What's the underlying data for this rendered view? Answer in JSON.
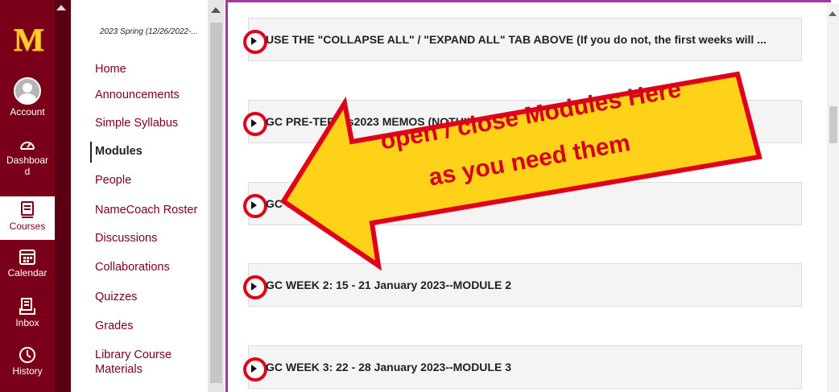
{
  "global_nav": {
    "logo": "M",
    "items": [
      {
        "label": "Account",
        "icon": "user-avatar-icon"
      },
      {
        "label": "Dashboar d",
        "icon": "dashboard-gauge-icon"
      },
      {
        "label": "Courses",
        "icon": "book-icon",
        "active": true
      },
      {
        "label": "Calendar",
        "icon": "calendar-icon"
      },
      {
        "label": "Inbox",
        "icon": "inbox-icon"
      },
      {
        "label": "History",
        "icon": "clock-icon"
      }
    ],
    "color": "#7a0019",
    "logo_color": "#ffcc33"
  },
  "course_nav": {
    "term": "2023 Spring (12/26/2022-...",
    "links": [
      {
        "label": "Home"
      },
      {
        "label": "Announcements"
      },
      {
        "label": "Simple Syllabus"
      },
      {
        "label": "Modules",
        "active": true
      },
      {
        "label": "People"
      },
      {
        "label": "NameCoach Roster"
      },
      {
        "label": "Discussions"
      },
      {
        "label": "Collaborations"
      },
      {
        "label": "Quizzes"
      },
      {
        "label": "Grades"
      },
      {
        "label": "Library Course Materials"
      }
    ]
  },
  "modules": [
    {
      "title": "USE THE \"COLLAPSE ALL\" / \"EXPAND ALL\" TAB ABOVE (If you do not, the first weeks will ..."
    },
    {
      "title": "GC PRE-TERM s2023 MEMOS (NOTHING"
    },
    {
      "title": "GC WEEK 1: ... --MODULE 1"
    },
    {
      "title": "GC WEEK 2: 15 - 21 January 2023--MODULE 2"
    },
    {
      "title": "GC WEEK 3: 22 - 28 January 2023--MODULE 3"
    }
  ],
  "callout": {
    "line1": "open / close Modules Here",
    "line2": "as you need them",
    "fill": "#ffd21a",
    "stroke": "#e0001a"
  }
}
